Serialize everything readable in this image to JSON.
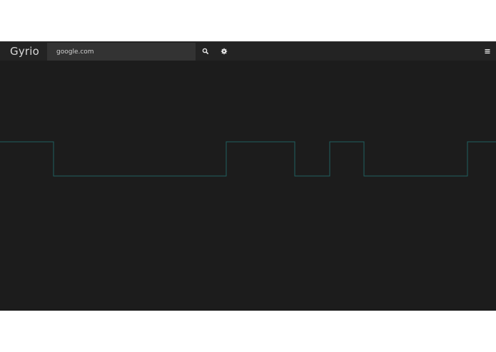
{
  "app": {
    "brand": "Gyrio"
  },
  "search": {
    "value": "google.com"
  },
  "icons": {
    "search": "search-icon",
    "settings": "gear-icon",
    "menu": "hamburger-menu-icon"
  },
  "colors": {
    "background": "#1c1c1c",
    "navbar": "#232323",
    "search_field": "#333333",
    "signal_line": "#1f5f5f"
  },
  "signal": {
    "description_levels": [
      "high",
      "low"
    ],
    "segments": [
      {
        "level": "high"
      },
      {
        "level": "low"
      },
      {
        "level": "high"
      },
      {
        "level": "low"
      },
      {
        "level": "high"
      },
      {
        "level": "low"
      },
      {
        "level": "high"
      }
    ]
  }
}
